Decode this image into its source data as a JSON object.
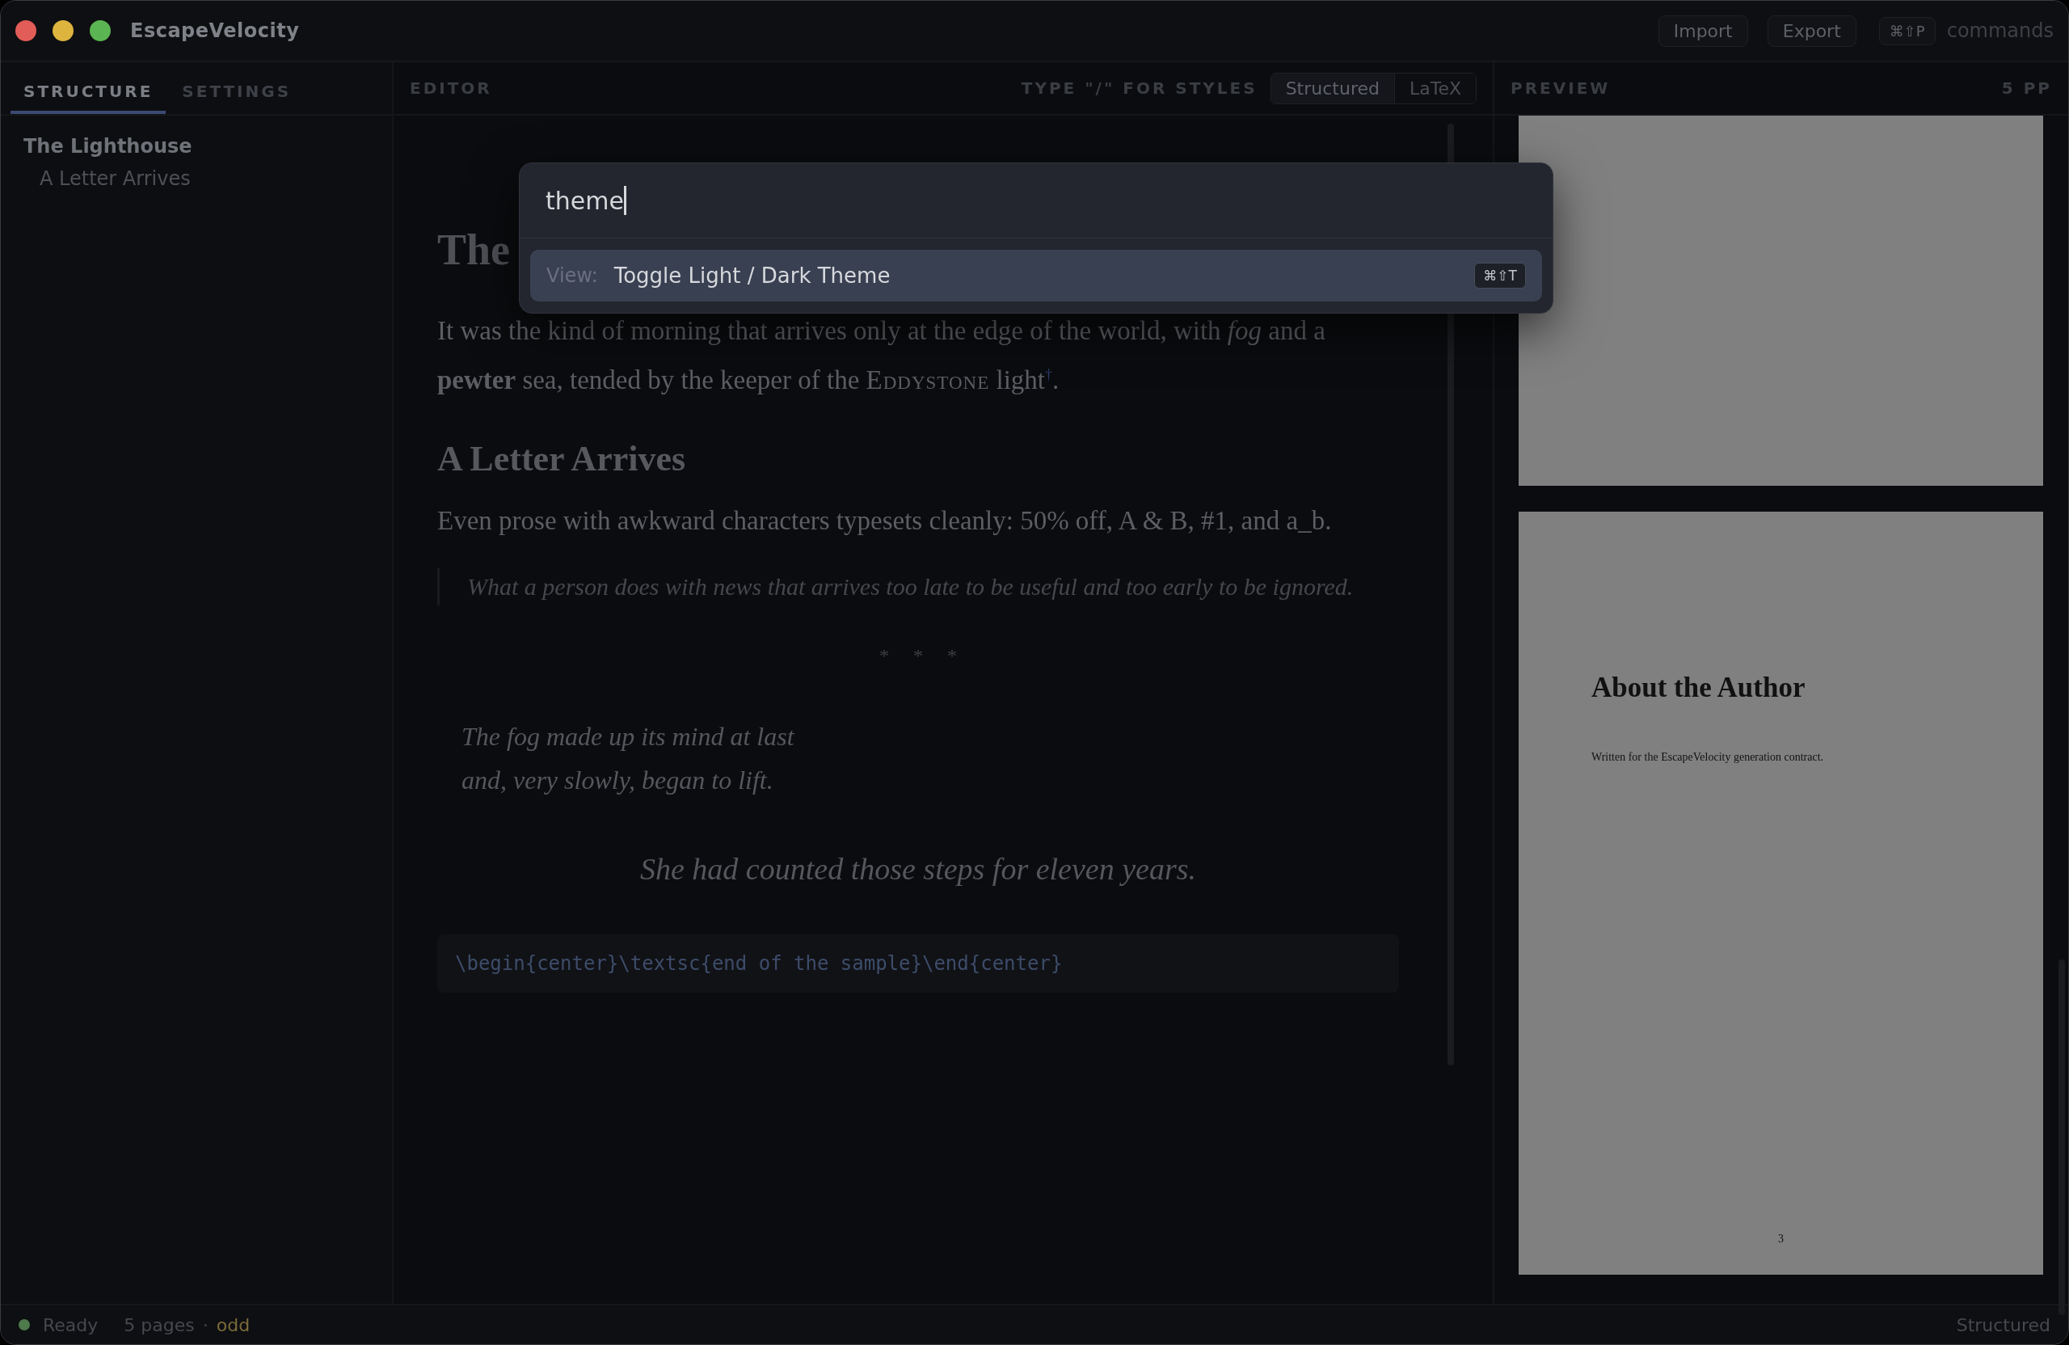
{
  "window": {
    "title": "EscapeVelocity"
  },
  "toolbar": {
    "buttons": [
      "Import",
      "Export"
    ],
    "shortcut": "⌘⇧P",
    "shortcut_label": "commands"
  },
  "sidebar": {
    "tabs": [
      {
        "label": "STRUCTURE",
        "selected": true
      },
      {
        "label": "SETTINGS",
        "selected": false
      }
    ],
    "outline": [
      {
        "label": "The Lighthouse",
        "children": [
          {
            "label": "A Letter Arrives"
          }
        ]
      }
    ]
  },
  "editor": {
    "title": "EDITOR",
    "hint": "TYPE \"/\" FOR STYLES",
    "modes": [
      {
        "label": "Structured",
        "selected": true
      },
      {
        "label": "LaTeX",
        "selected": false
      }
    ],
    "blocks": [
      {
        "kind": "title",
        "text": "The"
      },
      {
        "kind": "paragraph",
        "text": "It was the kind of morning that arrives only at the edge of the world, with *fog* and a **pewter** sea, tended by the keeper of the ",
        "small_caps": "Eddystone",
        "after": " light$^{†}$."
      },
      {
        "kind": "heading",
        "text": "A Letter Arrives"
      },
      {
        "kind": "paragraph",
        "text": "Even prose with awkward characters typesets cleanly: 50% off, A & B, #1, and a_b."
      },
      {
        "kind": "quote",
        "text": "What a person does with news that arrives too late to be useful and too early to be ignored."
      },
      {
        "kind": "break",
        "text": "*     *     *"
      },
      {
        "kind": "verse",
        "lines": [
          "The fog made up its mind at last",
          "and, very slowly, began to lift."
        ]
      },
      {
        "kind": "centered",
        "text": "She had counted those steps for eleven years."
      },
      {
        "kind": "code",
        "text": "\\begin{center}\\textsc{end of the sample}\\end{center}"
      }
    ]
  },
  "preview": {
    "title": "PREVIEW",
    "count": "5 PP",
    "pages": [
      {
        "kind": "blank"
      },
      {
        "kind": "text",
        "heading": "About the Author",
        "body": "Written for the EscapeVelocity generation contract.",
        "number": "3"
      }
    ]
  },
  "palette": {
    "value": "theme",
    "results": [
      {
        "category": "View:",
        "label": "Toggle Light / Dark Theme",
        "shortcut": "⌘⇧T",
        "selected": true
      }
    ]
  },
  "status_bar": {
    "state": "Ready",
    "color": "#4f7a4c",
    "pages": "5 pages",
    "separator": "·",
    "parity": "odd",
    "mode": "Structured"
  }
}
